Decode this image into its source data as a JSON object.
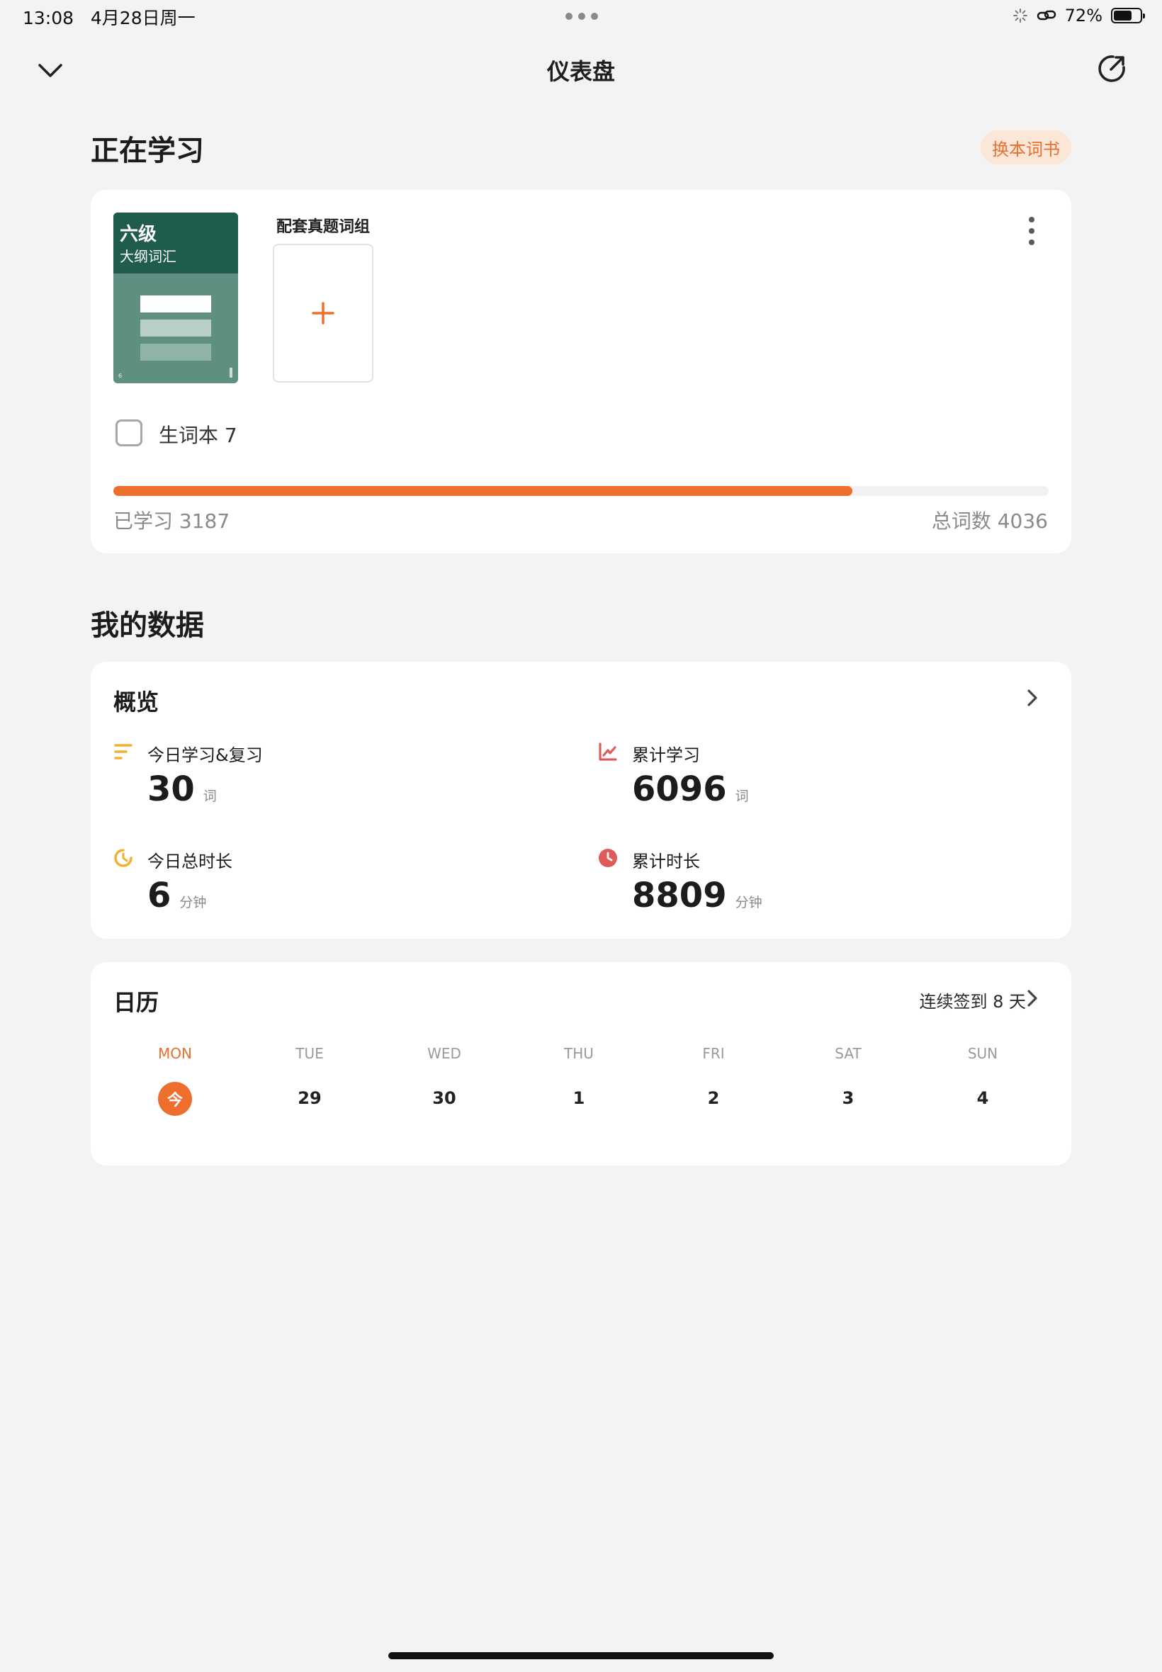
{
  "status_bar": {
    "time": "13:08",
    "date": "4月28日周一",
    "battery_percent": "72%",
    "battery_level": 0.72
  },
  "nav": {
    "title": "仪表盘",
    "back_icon": "chevron-down-icon",
    "share_icon": "share-icon"
  },
  "studying": {
    "section_title": "正在学习",
    "change_book_label": "换本词书",
    "book": {
      "title": "六级",
      "subtitle": "大纲词汇",
      "cover_number": "6"
    },
    "group_label": "配套真题词组",
    "vocab_book_label": "生词本 7",
    "learned_label": "已学习 3187",
    "total_label": "总词数 4036",
    "progress": 0.79
  },
  "my_data": {
    "section_title": "我的数据",
    "overview": {
      "title": "概览",
      "stats": [
        {
          "label": "今日学习&复习",
          "value": "30",
          "unit": "词",
          "icon": "list-icon",
          "color": "#f2b02e"
        },
        {
          "label": "累计学习",
          "value": "6096",
          "unit": "词",
          "icon": "line-chart-icon",
          "color": "#e05a5a"
        },
        {
          "label": "今日总时长",
          "value": "6",
          "unit": "分钟",
          "icon": "timer-icon",
          "color": "#f2b02e"
        },
        {
          "label": "累计时长",
          "value": "8809",
          "unit": "分钟",
          "icon": "clock-icon",
          "color": "#e05a5a"
        }
      ]
    }
  },
  "calendar": {
    "title": "日历",
    "streak_label": "连续签到 8 天",
    "days": [
      {
        "name": "MON",
        "date": "今",
        "today": true
      },
      {
        "name": "TUE",
        "date": "29"
      },
      {
        "name": "WED",
        "date": "30"
      },
      {
        "name": "THU",
        "date": "1"
      },
      {
        "name": "FRI",
        "date": "2"
      },
      {
        "name": "SAT",
        "date": "3"
      },
      {
        "name": "SUN",
        "date": "4"
      }
    ]
  },
  "colors": {
    "accent": "#ee6f2d",
    "background": "#f3f3f3",
    "card": "#ffffff",
    "cover_dark": "#1f5c4c",
    "cover_light": "#5e8f80"
  }
}
